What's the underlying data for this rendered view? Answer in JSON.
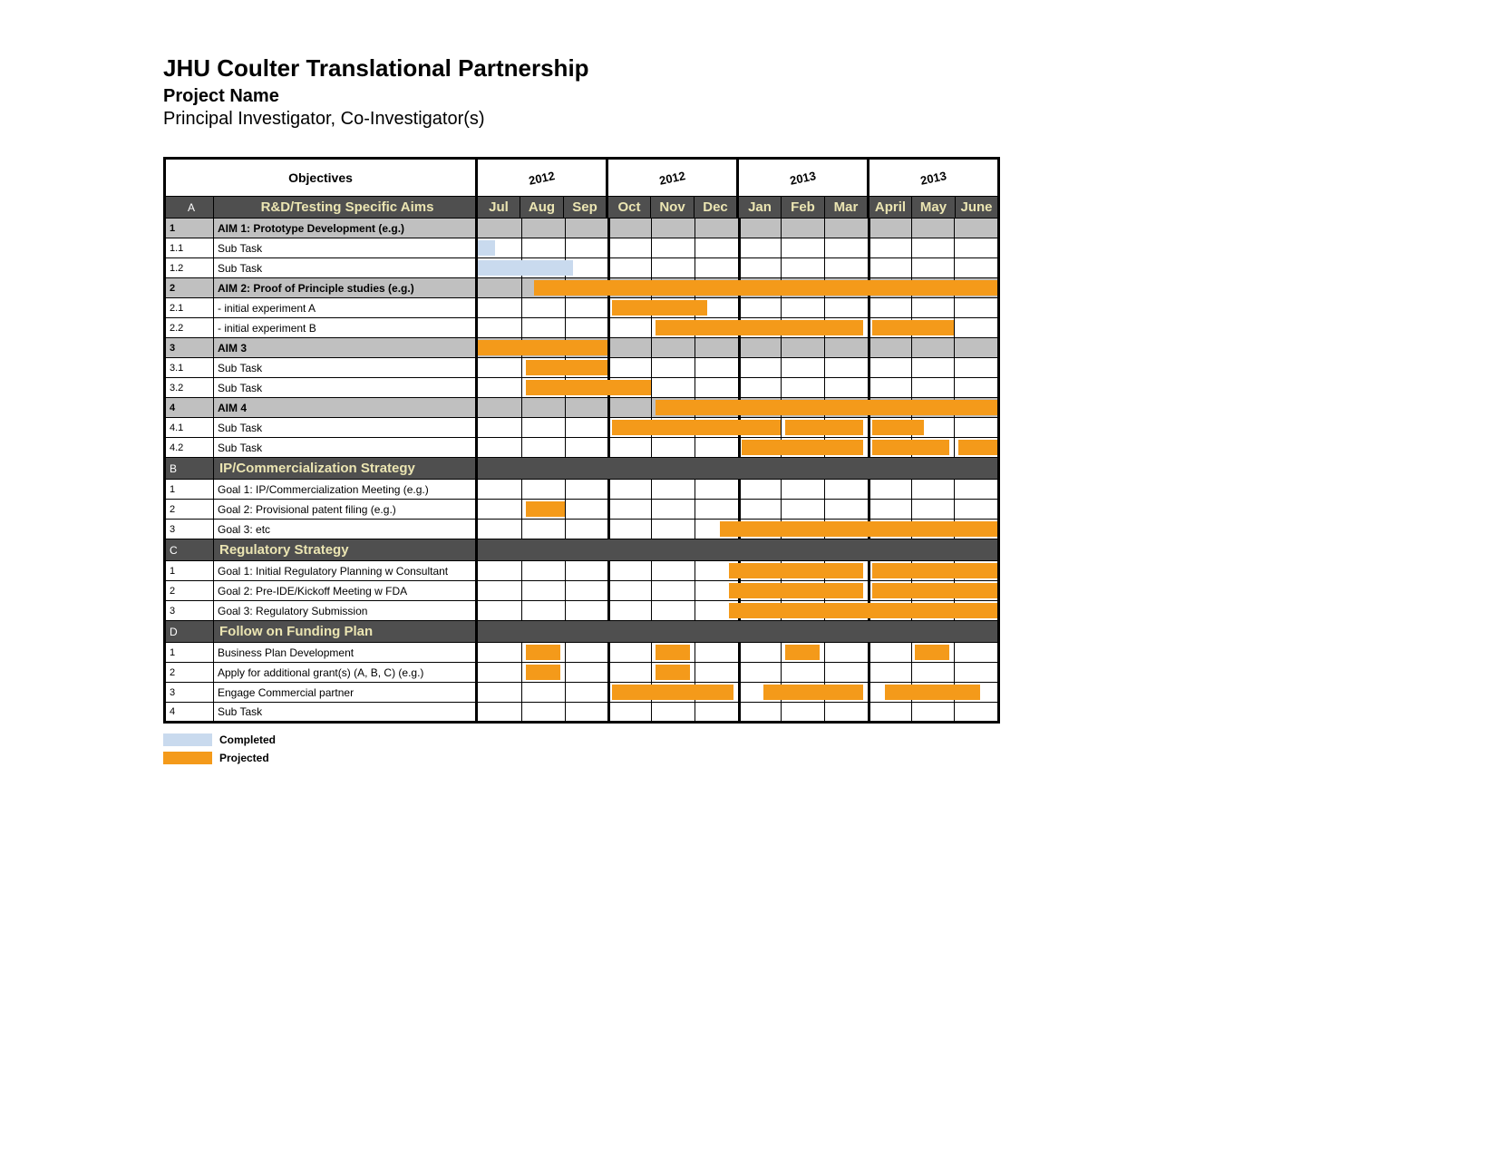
{
  "header": {
    "title": "JHU Coulter Translational Partnership",
    "project_name": "Project Name",
    "investigators": "Principal Investigator, Co-Investigator(s)",
    "objectives_label": "Objectives"
  },
  "years": [
    "2012",
    "2012",
    "2013",
    "2013"
  ],
  "months": [
    "Jul",
    "Aug",
    "Sep",
    "Oct",
    "Nov",
    "Dec",
    "Jan",
    "Feb",
    "Mar",
    "April",
    "May",
    "June"
  ],
  "legend": {
    "completed": "Completed",
    "projected": "Projected"
  },
  "colors": {
    "completed": "#c9daee",
    "projected": "#f49a1a",
    "section": "#4f4f4f"
  },
  "rows": [
    {
      "type": "section",
      "idx": "A",
      "label": "R&D/Testing Specific Aims"
    },
    {
      "type": "aim",
      "idx": "1",
      "label": "AIM 1: Prototype Development (e.g.)"
    },
    {
      "type": "task",
      "idx": "1.1",
      "label": "Sub Task",
      "bars": [
        {
          "kind": "completed",
          "start": 0,
          "end": 0.4
        }
      ]
    },
    {
      "type": "task",
      "idx": "1.2",
      "label": "Sub Task",
      "bars": [
        {
          "kind": "completed",
          "start": 0,
          "end": 2.2
        }
      ]
    },
    {
      "type": "aim",
      "idx": "2",
      "label": "AIM 2: Proof of Principle studies (e.g.)",
      "bars": [
        {
          "kind": "projected",
          "start": 1.3,
          "end": 12
        }
      ]
    },
    {
      "type": "task",
      "idx": "2.1",
      "label": " - initial experiment A",
      "bars": [
        {
          "kind": "projected",
          "start": 3.1,
          "end": 5.3
        }
      ]
    },
    {
      "type": "task",
      "idx": "2.2",
      "label": " - initial experiment B",
      "bars": [
        {
          "kind": "projected",
          "start": 4.1,
          "end": 8.9
        },
        {
          "kind": "projected",
          "start": 9.1,
          "end": 11
        }
      ]
    },
    {
      "type": "aim",
      "idx": "3",
      "label": "AIM 3",
      "bars": [
        {
          "kind": "projected",
          "start": 0,
          "end": 3
        }
      ]
    },
    {
      "type": "task",
      "idx": "3.1",
      "label": "Sub Task",
      "bars": [
        {
          "kind": "projected",
          "start": 1.1,
          "end": 3
        }
      ]
    },
    {
      "type": "task",
      "idx": "3.2",
      "label": "Sub Task",
      "bars": [
        {
          "kind": "projected",
          "start": 1.1,
          "end": 4
        }
      ]
    },
    {
      "type": "aim",
      "idx": "4",
      "label": "AIM 4",
      "bars": [
        {
          "kind": "projected",
          "start": 4.1,
          "end": 12
        }
      ]
    },
    {
      "type": "task",
      "idx": "4.1",
      "label": "Sub Task",
      "bars": [
        {
          "kind": "projected",
          "start": 3.1,
          "end": 7
        },
        {
          "kind": "projected",
          "start": 7.1,
          "end": 8.9
        },
        {
          "kind": "projected",
          "start": 9.1,
          "end": 10.3
        }
      ]
    },
    {
      "type": "task",
      "idx": "4.2",
      "label": "Sub Task",
      "bars": [
        {
          "kind": "projected",
          "start": 6.1,
          "end": 8.9
        },
        {
          "kind": "projected",
          "start": 9.1,
          "end": 10.9
        },
        {
          "kind": "projected",
          "start": 11.1,
          "end": 12
        }
      ]
    },
    {
      "type": "section",
      "idx": "B",
      "label": "IP/Commercialization Strategy"
    },
    {
      "type": "task",
      "idx": "1",
      "label": "Goal 1: IP/Commercialization Meeting (e.g.)"
    },
    {
      "type": "task",
      "idx": "2",
      "label": "Goal 2: Provisional patent filing (e.g.)",
      "bars": [
        {
          "kind": "projected",
          "start": 1.1,
          "end": 2
        }
      ]
    },
    {
      "type": "task",
      "idx": "3",
      "label": "Goal 3: etc",
      "bars": [
        {
          "kind": "projected",
          "start": 5.6,
          "end": 12
        }
      ]
    },
    {
      "type": "section",
      "idx": "C",
      "label": "Regulatory Strategy"
    },
    {
      "type": "task",
      "idx": "1",
      "label": "Goal 1: Initial Regulatory Planning w Consultant",
      "bars": [
        {
          "kind": "projected",
          "start": 5.8,
          "end": 8.9
        },
        {
          "kind": "projected",
          "start": 9.1,
          "end": 12
        }
      ]
    },
    {
      "type": "task",
      "idx": "2",
      "label": "Goal 2: Pre-IDE/Kickoff Meeting w FDA",
      "bars": [
        {
          "kind": "projected",
          "start": 5.8,
          "end": 8.9
        },
        {
          "kind": "projected",
          "start": 9.1,
          "end": 12
        }
      ]
    },
    {
      "type": "task",
      "idx": "3",
      "label": "Goal 3: Regulatory Submission",
      "bars": [
        {
          "kind": "projected",
          "start": 5.8,
          "end": 12
        }
      ]
    },
    {
      "type": "section",
      "idx": "D",
      "label": "Follow on Funding Plan"
    },
    {
      "type": "task",
      "idx": "1",
      "label": "Business Plan Development",
      "bars": [
        {
          "kind": "projected",
          "start": 1.1,
          "end": 1.9
        },
        {
          "kind": "projected",
          "start": 4.1,
          "end": 4.9
        },
        {
          "kind": "projected",
          "start": 7.1,
          "end": 7.9
        },
        {
          "kind": "projected",
          "start": 10.1,
          "end": 10.9
        }
      ]
    },
    {
      "type": "task",
      "idx": "2",
      "label": "Apply for additional grant(s) (A, B, C) (e.g.)",
      "bars": [
        {
          "kind": "projected",
          "start": 1.1,
          "end": 1.9
        },
        {
          "kind": "projected",
          "start": 4.1,
          "end": 4.9
        }
      ]
    },
    {
      "type": "task",
      "idx": "3",
      "label": "Engage Commercial partner",
      "bars": [
        {
          "kind": "projected",
          "start": 3.1,
          "end": 5.9
        },
        {
          "kind": "projected",
          "start": 6.6,
          "end": 8.9
        },
        {
          "kind": "projected",
          "start": 9.4,
          "end": 11.6
        }
      ]
    },
    {
      "type": "task",
      "idx": "4",
      "label": "Sub Task"
    }
  ],
  "chart_data": {
    "type": "gantt",
    "title": "JHU Coulter Translational Partnership — Project Name",
    "x_axis_months": [
      "Jul 2012",
      "Aug 2012",
      "Sep 2012",
      "Oct 2012",
      "Nov 2012",
      "Dec 2012",
      "Jan 2013",
      "Feb 2013",
      "Mar 2013",
      "Apr 2013",
      "May 2013",
      "Jun 2013"
    ],
    "legend": [
      "Completed",
      "Projected"
    ],
    "tasks": [
      {
        "section": "R&D/Testing Specific Aims",
        "id": "A"
      },
      {
        "id": "1",
        "name": "AIM 1: Prototype Development (e.g.)"
      },
      {
        "id": "1.1",
        "name": "Sub Task",
        "status": "Completed",
        "start": "Jul 2012",
        "end": "Jul 2012"
      },
      {
        "id": "1.2",
        "name": "Sub Task",
        "status": "Completed",
        "start": "Jul 2012",
        "end": "Sep 2012"
      },
      {
        "id": "2",
        "name": "AIM 2: Proof of Principle studies (e.g.)",
        "status": "Projected",
        "start": "Aug 2012",
        "end": "Jun 2013"
      },
      {
        "id": "2.1",
        "name": "initial experiment A",
        "status": "Projected",
        "start": "Oct 2012",
        "end": "Dec 2012"
      },
      {
        "id": "2.2",
        "name": "initial experiment B",
        "status": "Projected",
        "start": "Nov 2012",
        "end": "May 2013"
      },
      {
        "id": "3",
        "name": "AIM 3",
        "status": "Projected",
        "start": "Jul 2012",
        "end": "Sep 2012"
      },
      {
        "id": "3.1",
        "name": "Sub Task",
        "status": "Projected",
        "start": "Aug 2012",
        "end": "Sep 2012"
      },
      {
        "id": "3.2",
        "name": "Sub Task",
        "status": "Projected",
        "start": "Aug 2012",
        "end": "Oct 2012"
      },
      {
        "id": "4",
        "name": "AIM 4",
        "status": "Projected",
        "start": "Nov 2012",
        "end": "Jun 2013"
      },
      {
        "id": "4.1",
        "name": "Sub Task",
        "status": "Projected",
        "start": "Oct 2012",
        "end": "Apr 2013"
      },
      {
        "id": "4.2",
        "name": "Sub Task",
        "status": "Projected",
        "start": "Jan 2013",
        "end": "Jun 2013"
      },
      {
        "section": "IP/Commercialization Strategy",
        "id": "B"
      },
      {
        "id": "1",
        "name": "Goal 1: IP/Commercialization Meeting (e.g.)"
      },
      {
        "id": "2",
        "name": "Goal 2: Provisional patent filing (e.g.)",
        "status": "Projected",
        "start": "Aug 2012",
        "end": "Aug 2012"
      },
      {
        "id": "3",
        "name": "Goal 3: etc",
        "status": "Projected",
        "start": "Dec 2012",
        "end": "Jun 2013"
      },
      {
        "section": "Regulatory Strategy",
        "id": "C"
      },
      {
        "id": "1",
        "name": "Goal 1: Initial Regulatory Planning w Consultant",
        "status": "Projected",
        "start": "Dec 2012",
        "end": "Jun 2013"
      },
      {
        "id": "2",
        "name": "Goal 2: Pre-IDE/Kickoff Meeting w FDA",
        "status": "Projected",
        "start": "Dec 2012",
        "end": "Jun 2013"
      },
      {
        "id": "3",
        "name": "Goal 3: Regulatory Submission",
        "status": "Projected",
        "start": "Dec 2012",
        "end": "Jun 2013"
      },
      {
        "section": "Follow on Funding Plan",
        "id": "D"
      },
      {
        "id": "1",
        "name": "Business Plan Development",
        "status": "Projected",
        "start": "Aug 2012",
        "end": "May 2013"
      },
      {
        "id": "2",
        "name": "Apply for additional grant(s) (A, B, C) (e.g.)",
        "status": "Projected",
        "start": "Aug 2012",
        "end": "Nov 2012"
      },
      {
        "id": "3",
        "name": "Engage Commercial partner",
        "status": "Projected",
        "start": "Oct 2012",
        "end": "May 2013"
      },
      {
        "id": "4",
        "name": "Sub Task"
      }
    ]
  }
}
